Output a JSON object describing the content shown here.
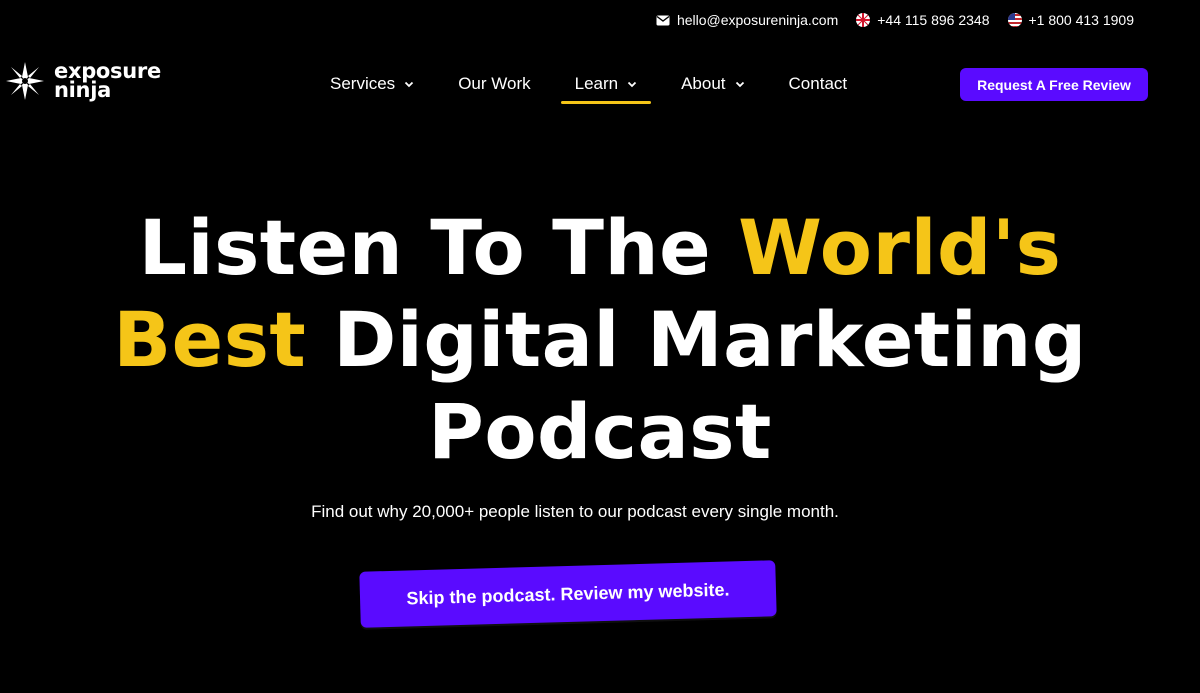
{
  "topbar": {
    "email": "hello@exposureninja.com",
    "phone_uk": "+44 115 896 2348",
    "phone_us": "+1 800 413 1909"
  },
  "logo": {
    "line1": "exposure",
    "line2": "ninja"
  },
  "nav": {
    "items": [
      {
        "label": "Services",
        "dropdown": true,
        "active": false
      },
      {
        "label": "Our Work",
        "dropdown": false,
        "active": false
      },
      {
        "label": "Learn",
        "dropdown": true,
        "active": true
      },
      {
        "label": "About",
        "dropdown": true,
        "active": false
      },
      {
        "label": "Contact",
        "dropdown": false,
        "active": false
      }
    ],
    "cta_label": "Request A Free Review"
  },
  "hero": {
    "title_part1": "Listen To The ",
    "title_accent1": "World's",
    "title_accent2": "Best",
    "title_part2": " Digital Marketing",
    "title_part3": "Podcast",
    "subtitle": "Find out why 20,000+ people listen to our podcast every single month.",
    "cta_label": "Skip the podcast. Review my website."
  },
  "colors": {
    "background": "#000000",
    "accent_yellow": "#f5c518",
    "brand_purple": "#5a0bff",
    "text": "#ffffff"
  },
  "icons": {
    "email": "envelope-icon",
    "uk_flag": "uk-flag-icon",
    "us_flag": "us-flag-icon",
    "logo": "ninja-star-icon",
    "dropdown": "chevron-down-icon"
  }
}
